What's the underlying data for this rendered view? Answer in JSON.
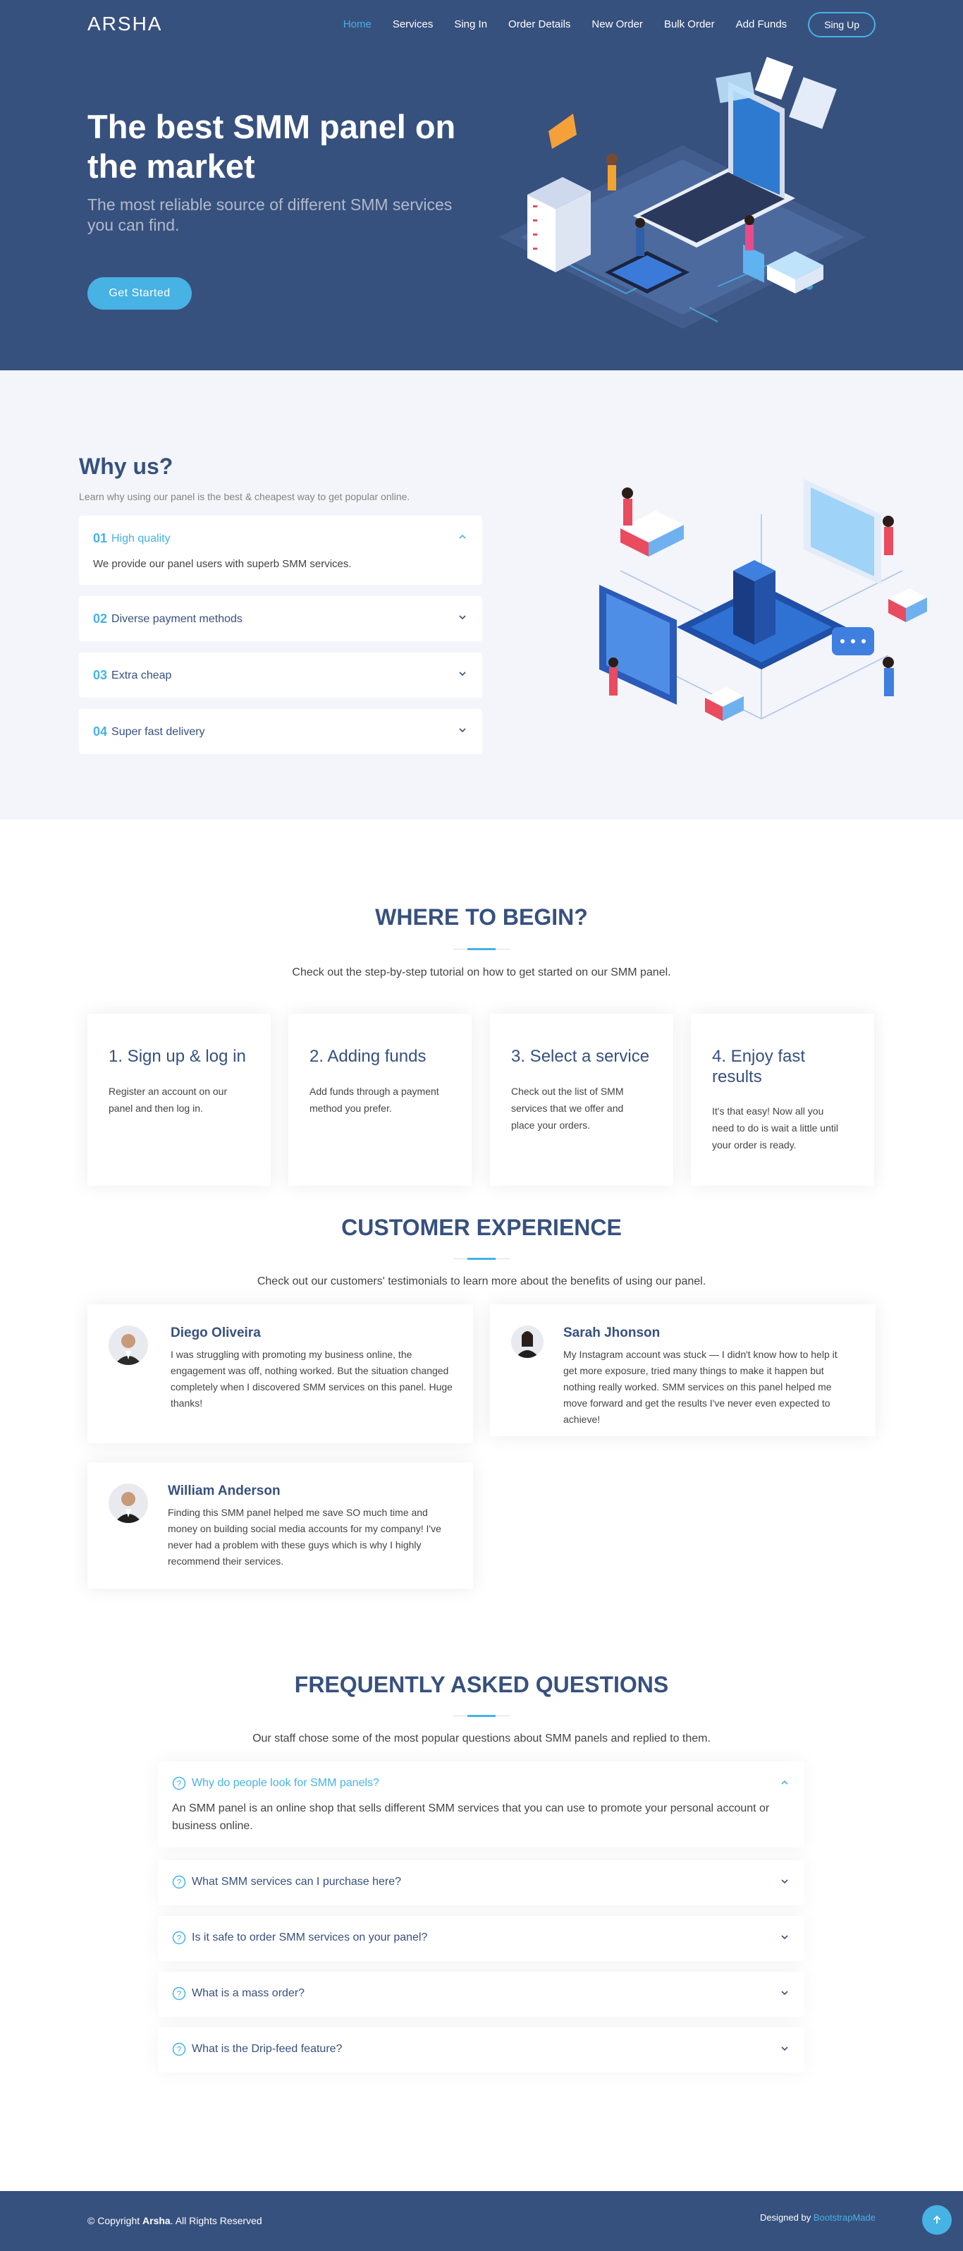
{
  "brand": {
    "logo": "ARSHA",
    "accent": "#47b2e4",
    "primary": "#37517e"
  },
  "nav": {
    "items": [
      "Home",
      "Services",
      "Sing In",
      "Order Details",
      "New Order",
      "Bulk Order",
      "Add Funds"
    ],
    "active": "Home",
    "signup": "Sing Up"
  },
  "hero": {
    "title": "The best SMM panel on the market",
    "subtitle": "The most reliable source of different SMM services you can find.",
    "cta": "Get Started",
    "illustration": "isometric-laptop-server-illustration"
  },
  "why": {
    "title": "Why us?",
    "subtitle": "Learn why using our panel is the best & cheapest way to get popular online.",
    "items": [
      {
        "num": "01",
        "title": "High quality",
        "body": "We provide our panel users with superb SMM services.",
        "open": true
      },
      {
        "num": "02",
        "title": "Diverse payment methods",
        "open": false
      },
      {
        "num": "03",
        "title": "Extra cheap",
        "open": false
      },
      {
        "num": "04",
        "title": "Super fast delivery",
        "open": false
      }
    ],
    "illustration": "isometric-city-office-illustration"
  },
  "steps": {
    "title": "WHERE TO BEGIN?",
    "desc": "Check out the step-by-step tutorial on how to get started on our SMM panel.",
    "cards": [
      {
        "title": "1. Sign up & log in",
        "body": "Register an account on our panel and then log in."
      },
      {
        "title": "2. Adding funds",
        "body": "Add funds through a payment method you prefer."
      },
      {
        "title": "3. Select a service",
        "body": "Check out the list of SMM services that we offer and place your orders."
      },
      {
        "title": "4. Enjoy fast results",
        "body": "It's that easy! Now all you need to do is wait a little until your order is ready."
      }
    ]
  },
  "testimonials": {
    "title": "CUSTOMER EXPERIENCE",
    "desc": "Check out our customers' testimonials to learn more about the benefits of using our panel.",
    "items": [
      {
        "name": "Diego Oliveira",
        "text": "I was struggling with promoting my business online, the engagement was off, nothing worked. But the situation changed completely when I discovered SMM services on this panel. Huge thanks!"
      },
      {
        "name": "Sarah Jhonson",
        "text": "My Instagram account was stuck — I didn't know how to help it get more exposure, tried many things to make it happen but nothing really worked. SMM services on this panel helped me move forward and get the results I've never even expected to achieve!"
      },
      {
        "name": "William Anderson",
        "text": "Finding this SMM panel helped me save SO much time and money on building social media accounts for my company! I've never had a problem with these guys which is why I highly recommend their services."
      }
    ]
  },
  "faq": {
    "title": "FREQUENTLY ASKED QUESTIONS",
    "desc": "Our staff chose some of the most popular questions about SMM panels and replied to them.",
    "items": [
      {
        "q": "Why do people look for SMM panels?",
        "a": "An SMM panel is an online shop that sells different SMM services that you can use to promote your personal account or business online.",
        "open": true
      },
      {
        "q": "What SMM services can I purchase here?",
        "open": false
      },
      {
        "q": "Is it safe to order SMM services on your panel?",
        "open": false
      },
      {
        "q": "What is a mass order?",
        "open": false
      },
      {
        "q": "What is the Drip-feed feature?",
        "open": false
      }
    ]
  },
  "footer": {
    "copy_prefix": "© Copyright ",
    "copy_brand": "Arsha",
    "copy_suffix": ". All Rights Reserved",
    "designed_prefix": "Designed by ",
    "designed_link": "BootstrapMade"
  }
}
